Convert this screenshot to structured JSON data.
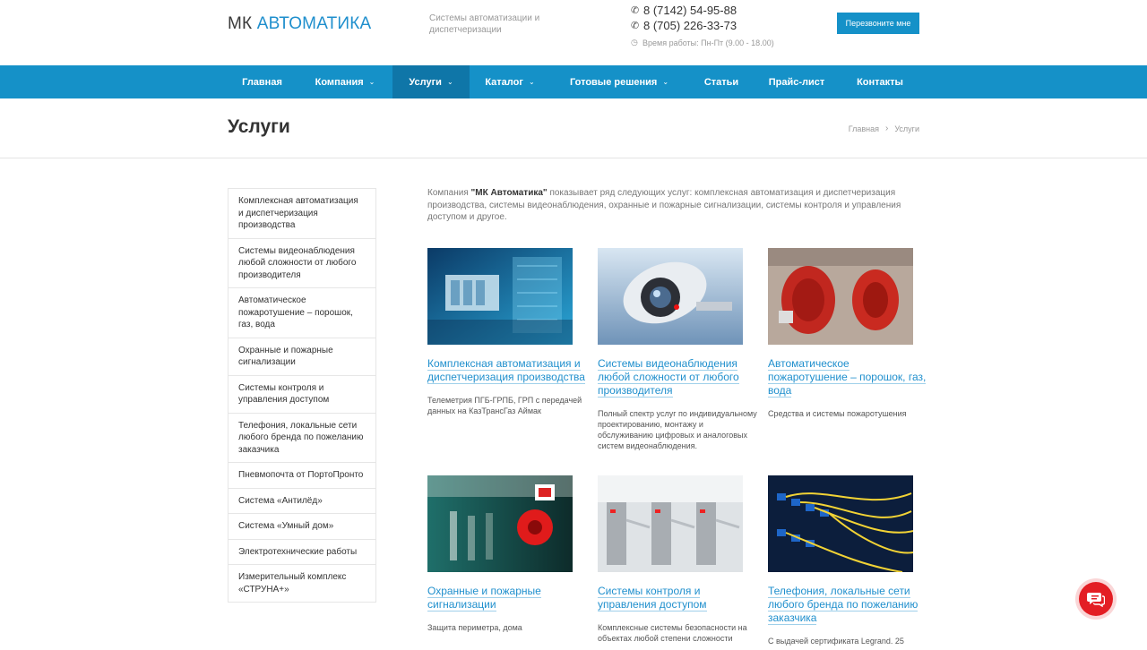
{
  "header": {
    "logo_mk": "МК",
    "logo_brand": "АВТОМАТИКА",
    "tagline": "Системы автоматизации и диспетчеризации",
    "phones": [
      "8 (7142) 54-95-88",
      "8 (705) 226-33-73"
    ],
    "work_hours": "Время работы: Пн-Пт (9.00 - 18.00)",
    "callback_label": "Перезвоните мне"
  },
  "nav": {
    "items": [
      {
        "label": "Главная",
        "dropdown": false
      },
      {
        "label": "Компания",
        "dropdown": true
      },
      {
        "label": "Услуги",
        "dropdown": true,
        "active": true
      },
      {
        "label": "Каталог",
        "dropdown": true
      },
      {
        "label": "Готовые решения",
        "dropdown": true
      },
      {
        "label": "Статьи",
        "dropdown": false
      },
      {
        "label": "Прайс-лист",
        "dropdown": false
      },
      {
        "label": "Контакты",
        "dropdown": false
      }
    ]
  },
  "page": {
    "title": "Услуги",
    "breadcrumb": [
      "Главная",
      "Услуги"
    ]
  },
  "sidebar": {
    "items": [
      "Комплексная автоматизация и диспетчеризация производства",
      "Системы видеонаблюдения любой сложности от любого производителя",
      "Автоматическое пожаротушение – порошок, газ, вода",
      "Охранные и пожарные сигнализации",
      "Системы контроля и управления доступом",
      "Телефония, локальные сети любого бренда по пожеланию заказчика",
      "Пневмопочта от ПортоПронто",
      "Система «Антилёд»",
      "Система «Умный дом»",
      "Электротехнические работы",
      "Измерительный комплекс «СТРУНА+»"
    ]
  },
  "intro": {
    "prefix": "Компания ",
    "company": "\"МК Автоматика\"",
    "text": " показывает ряд следующих услуг: комплексная автоматизация и диспетчеризация производства, системы видеонаблюдения, охранные и пожарные сигнализации, системы контроля и управления доступом и другое."
  },
  "services": [
    {
      "title": "Комплексная автоматизация и диспетчеризация производства",
      "desc": "Телеметрия ПГБ-ГРПБ, ГРП с передачей данных на КазТрансГаз Аймак",
      "image_icon": "automation-panel-image"
    },
    {
      "title": "Системы видеонаблюдения любой сложности от любого производителя",
      "desc": "Полный спектр услуг по индивидуальному проектированию, монтажу и обслуживанию цифровых и аналоговых систем видеонаблюдения.",
      "image_icon": "cctv-camera-image"
    },
    {
      "title": "Автоматическое пожаротушение – порошок, газ, вода",
      "desc": "Средства и системы пожаротушения",
      "image_icon": "fire-extinguisher-image"
    },
    {
      "title": "Охранные и пожарные сигнализации",
      "desc": "Защита периметра, дома",
      "image_icon": "fire-alarm-image"
    },
    {
      "title": "Системы контроля и управления доступом",
      "desc": "Комплексные системы безопасности на объектах любой степени сложности",
      "image_icon": "turnstile-image"
    },
    {
      "title": "Телефония, локальные сети любого бренда по пожеланию заказчика",
      "desc": "С выдачей сертификата Legrand. 25",
      "image_icon": "network-cables-image"
    }
  ],
  "colors": {
    "accent": "#1591c8",
    "nav_active": "#0f76a8",
    "link": "#1f8fcd",
    "chat": "#e31e24"
  }
}
